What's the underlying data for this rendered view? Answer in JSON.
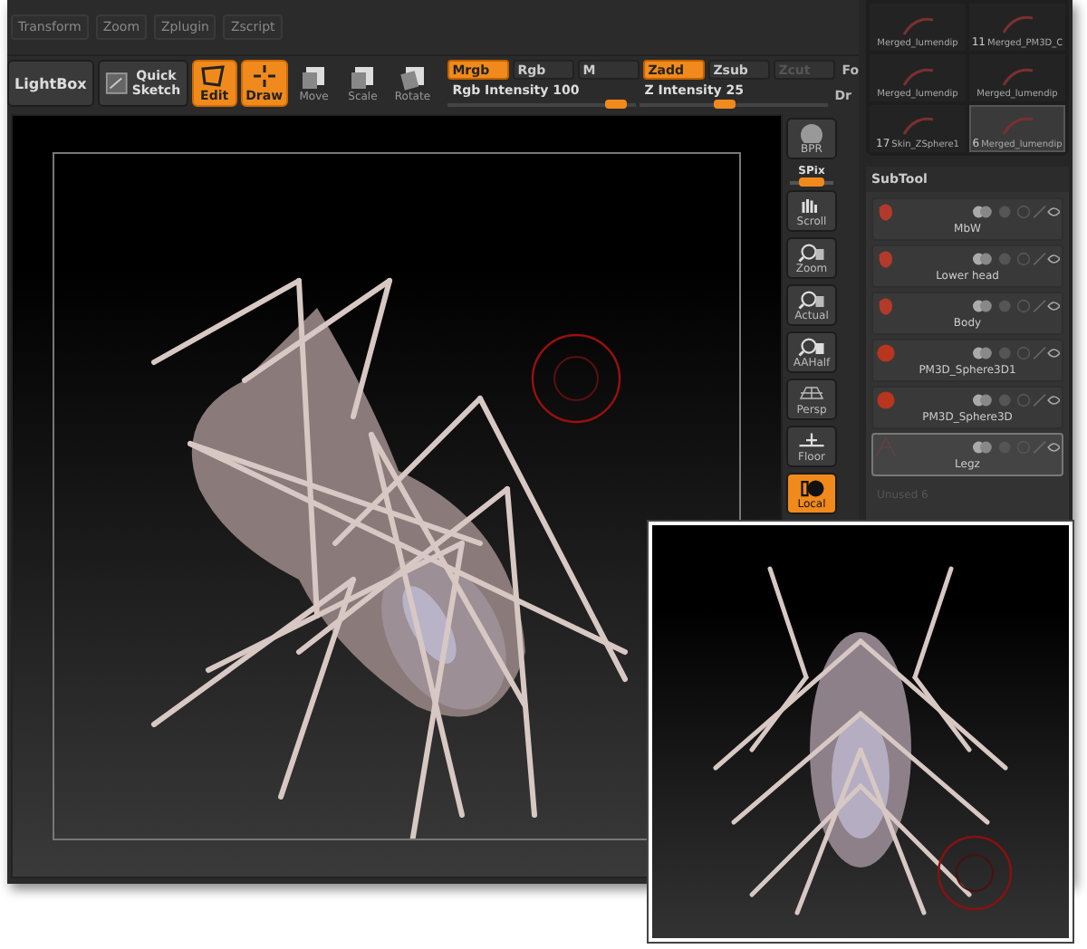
{
  "menu": [
    "Transform",
    "Zoom",
    "Zplugin",
    "Zscript"
  ],
  "toolbar": {
    "buttons": [
      {
        "label": "LightBox",
        "kind": "plain",
        "selected": false
      },
      {
        "label": "Quick Sketch",
        "kind": "sketch",
        "selected": false
      },
      {
        "label": "Edit",
        "kind": "edit",
        "selected": true
      },
      {
        "label": "Draw",
        "kind": "draw",
        "selected": true
      },
      {
        "label": "Move",
        "kind": "move",
        "selected": false
      },
      {
        "label": "Scale",
        "kind": "scale",
        "selected": false
      },
      {
        "label": "Rotate",
        "kind": "rotate",
        "selected": false
      }
    ],
    "color_modes": [
      {
        "label": "Mrgb",
        "selected": true,
        "disabled": false
      },
      {
        "label": "Rgb",
        "selected": false,
        "disabled": false
      },
      {
        "label": "M",
        "selected": false,
        "disabled": false
      }
    ],
    "depth_modes": [
      {
        "label": "Zadd",
        "selected": true,
        "disabled": false
      },
      {
        "label": "Zsub",
        "selected": false,
        "disabled": false
      },
      {
        "label": "Zcut",
        "selected": false,
        "disabled": true
      }
    ],
    "sliders": [
      {
        "label": "Rgb Intensity",
        "value": "100",
        "level": 0.9
      },
      {
        "label": "Z Intensity",
        "value": "25",
        "level": 0.45
      }
    ],
    "edge_labels": [
      "Fo",
      "Dr"
    ]
  },
  "view_buttons": [
    {
      "label": "BPR",
      "kind": "bpr",
      "selected": false
    },
    {
      "label": "SPix",
      "kind": "slider",
      "level": 0.5
    },
    {
      "label": "Scroll",
      "kind": "scroll",
      "selected": false
    },
    {
      "label": "Zoom",
      "kind": "zoom",
      "selected": false
    },
    {
      "label": "Actual",
      "kind": "actual",
      "selected": false
    },
    {
      "label": "AAHalf",
      "kind": "aahalf",
      "selected": false
    },
    {
      "label": "Persp",
      "kind": "persp",
      "selected": false
    },
    {
      "label": "Floor",
      "kind": "floor",
      "selected": false
    },
    {
      "label": "Local",
      "kind": "local",
      "selected": true
    }
  ],
  "tool_thumbnails": [
    {
      "name": "Merged_lumendip",
      "selected": false
    },
    {
      "count": "11",
      "name": "Merged_PM3D_C",
      "selected": false
    },
    {
      "name": "Merged_lumendip",
      "selected": false
    },
    {
      "name": "Merged_lumendip",
      "selected": false
    },
    {
      "count": "17",
      "name": "Skin_ZSphere1",
      "selected": false
    },
    {
      "count": "6",
      "name": "Merged_lumendip",
      "selected": true
    }
  ],
  "subtool": {
    "title": "SubTool",
    "items": [
      {
        "name": "MbW",
        "kind": "blob",
        "selected": false
      },
      {
        "name": "Lower head",
        "kind": "blob",
        "selected": false
      },
      {
        "name": "Body",
        "kind": "blob",
        "selected": false
      },
      {
        "name": "PM3D_Sphere3D1",
        "kind": "sphere",
        "selected": false
      },
      {
        "name": "PM3D_Sphere3D",
        "kind": "sphere",
        "selected": false
      },
      {
        "name": "Legz",
        "kind": "legs",
        "selected": true
      }
    ],
    "unused": "Unused 6"
  }
}
